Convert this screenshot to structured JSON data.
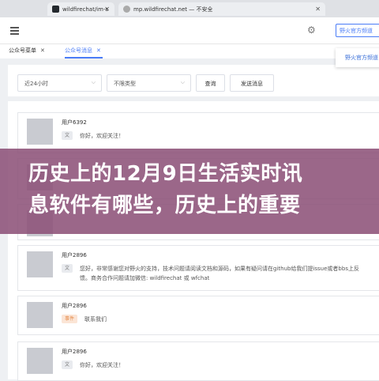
{
  "browser": {
    "tabs": [
      {
        "label": "wildfirechat/im-s"
      },
      {
        "label": "mp.wildfirechat.net — 不安全"
      }
    ]
  },
  "header": {
    "search_value": "野火官方频道",
    "dropdown_item": "野火官方频道"
  },
  "page_tabs": [
    {
      "label": "公众号菜单"
    },
    {
      "label": "公众号消息"
    }
  ],
  "filters": {
    "time_range": "近24小时",
    "type": "不限类型",
    "search_button": "查询",
    "send_button": "发送消息"
  },
  "messages": [
    {
      "user": "用户6392",
      "tag": "文",
      "lines": [
        "你好，欢迎关注！"
      ]
    },
    {
      "user": "用户2896",
      "tag": "文",
      "lines": [
        "您好，非常感谢您对野火的支持，技术问题请阅读文档和源码，如果有疑问请在github给我们提issue或者bbs上反",
        "馈。商务合作问题请加微信: wildfirechat 或 wfchat"
      ]
    },
    {
      "user": "用户2896",
      "tag": "事件",
      "lines": [
        "联系我们"
      ]
    },
    {
      "user": "用户2896",
      "tag": "文",
      "lines": [
        "你好，欢迎关注！"
      ]
    }
  ],
  "banner": {
    "line1": "历史上的12月9日生活实时讯",
    "line2": "息软件有哪些，历史上的重要"
  }
}
